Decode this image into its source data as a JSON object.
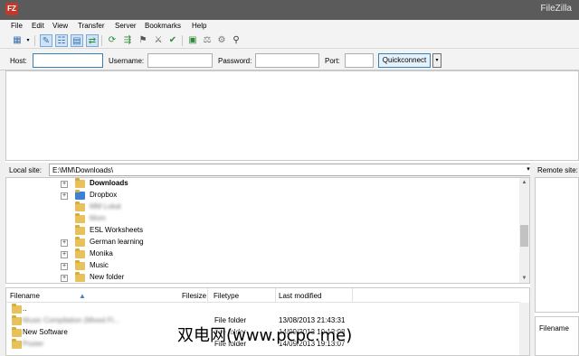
{
  "window": {
    "title": "FileZilla",
    "app_icon": "FZ"
  },
  "menu": [
    "File",
    "Edit",
    "View",
    "Transfer",
    "Server",
    "Bookmarks",
    "Help"
  ],
  "toolbar": {
    "icons": [
      "site-manager-icon",
      "dropdown-icon",
      "toggle-message-log-icon",
      "toggle-local-tree-icon",
      "toggle-remote-tree-icon",
      "toggle-transfer-queue-icon",
      "refresh-icon",
      "process-queue-icon",
      "cancel-icon",
      "disconnect-icon",
      "reconnect-icon",
      "directory-listing-filters-icon",
      "compare-icon",
      "sync-browse-icon",
      "search-icon"
    ]
  },
  "quickconnect": {
    "host_label": "Host:",
    "username_label": "Username:",
    "password_label": "Password:",
    "port_label": "Port:",
    "host_value": "",
    "username_value": "",
    "password_value": "",
    "port_value": "",
    "button_label": "Quickconnect",
    "arrow": "▾"
  },
  "local": {
    "site_label": "Local site:",
    "path": "E:\\MM\\Downloads\\",
    "tree": [
      {
        "name": "Downloads",
        "expander": "+",
        "selected": true,
        "blurred": false
      },
      {
        "name": "Dropbox",
        "expander": "+",
        "selected": false,
        "blurred": false
      },
      {
        "name": "MM Lokal",
        "expander": "",
        "selected": false,
        "blurred": true
      },
      {
        "name": "Mom",
        "expander": "",
        "selected": false,
        "blurred": true
      },
      {
        "name": "ESL Worksheets",
        "expander": "",
        "selected": false,
        "blurred": false
      },
      {
        "name": "German learning",
        "expander": "+",
        "selected": false,
        "blurred": false
      },
      {
        "name": "Monika",
        "expander": "+",
        "selected": false,
        "blurred": false
      },
      {
        "name": "Music",
        "expander": "+",
        "selected": false,
        "blurred": false
      },
      {
        "name": "New folder",
        "expander": "+",
        "selected": false,
        "blurred": false
      }
    ],
    "columns": {
      "filename": "Filename",
      "filesize": "Filesize",
      "filetype": "Filetype",
      "modified": "Last modified"
    },
    "files": [
      {
        "name": "..",
        "type": "",
        "modified": "",
        "blurred": false
      },
      {
        "name": "Music Compilation (Mixed Fi...",
        "type": "File folder",
        "modified": "13/08/2013 21:43:31",
        "blurred": true
      },
      {
        "name": "New Software",
        "type": "File folder",
        "modified": "14/09/2013 19:13:08",
        "blurred": false
      },
      {
        "name": "Poster",
        "type": "File folder",
        "modified": "14/09/2013 19:13:07",
        "blurred": true
      }
    ]
  },
  "remote": {
    "site_label": "Remote site:",
    "columns": {
      "filename": "Filename"
    }
  },
  "watermark": "双电网(www.pcpc.me)"
}
